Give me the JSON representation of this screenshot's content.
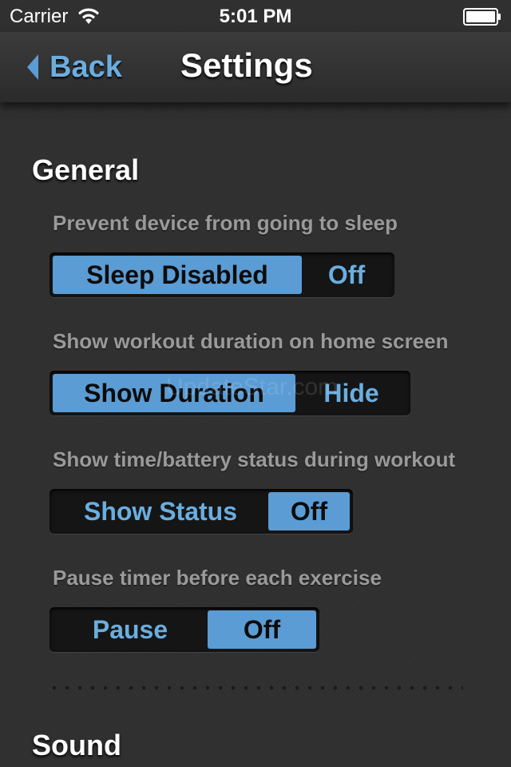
{
  "status_bar": {
    "carrier": "Carrier",
    "time": "5:01 PM",
    "wifi_icon": "wifi-icon",
    "battery_icon": "battery-full-icon"
  },
  "nav": {
    "back_label": "Back",
    "title": "Settings"
  },
  "sections": {
    "general": "General",
    "sound": "Sound"
  },
  "options": [
    {
      "label": "Prevent device from going to sleep",
      "on_label": "Sleep Disabled",
      "off_label": "Off",
      "selected": "on"
    },
    {
      "label": "Show workout duration on home screen",
      "on_label": "Show Duration",
      "off_label": "Hide",
      "selected": "on"
    },
    {
      "label": "Show time/battery status during workout",
      "on_label": "Show Status",
      "off_label": "Off",
      "selected": "off"
    },
    {
      "label": "Pause timer before each exercise",
      "on_label": "Pause",
      "off_label": "Off",
      "selected": "off"
    }
  ],
  "watermark": "UpdateStar.com",
  "colors": {
    "accent": "#5b9cd4",
    "accent_text": "#6aaee0",
    "background": "#303030"
  }
}
